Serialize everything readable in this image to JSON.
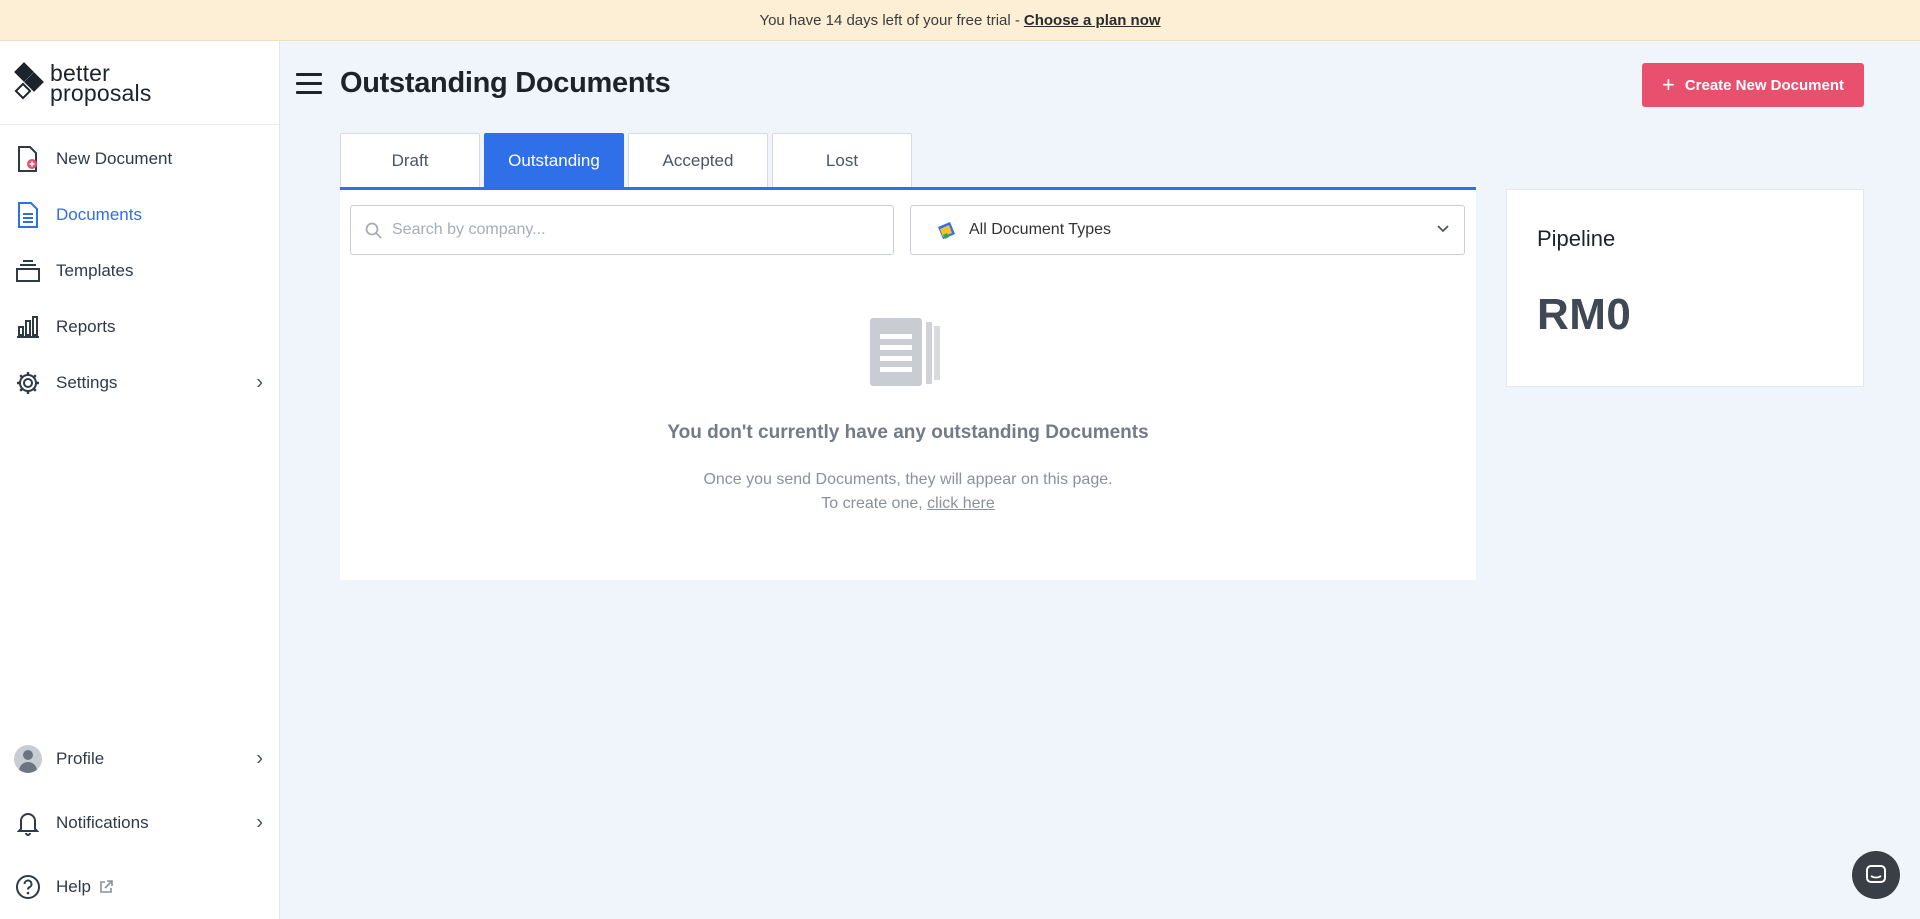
{
  "banner": {
    "text": "You have 14 days left of your free trial -",
    "link": "Choose a plan now"
  },
  "brand": {
    "line1": "better",
    "line2": "proposals"
  },
  "sidebar": {
    "items": [
      {
        "label": "New Document",
        "icon": "new-document-icon"
      },
      {
        "label": "Documents",
        "icon": "documents-icon",
        "active": true
      },
      {
        "label": "Templates",
        "icon": "templates-icon"
      },
      {
        "label": "Reports",
        "icon": "reports-icon"
      },
      {
        "label": "Settings",
        "icon": "gear-icon"
      }
    ],
    "bottom": [
      {
        "label": "Profile",
        "icon": "avatar"
      },
      {
        "label": "Notifications",
        "icon": "bell-icon"
      },
      {
        "label": "Help",
        "icon": "help-icon"
      }
    ]
  },
  "header": {
    "title": "Outstanding Documents",
    "create_label": "Create New Document"
  },
  "tabs": [
    {
      "label": "Draft"
    },
    {
      "label": "Outstanding",
      "active": true
    },
    {
      "label": "Accepted"
    },
    {
      "label": "Lost"
    }
  ],
  "filters": {
    "search_placeholder": "Search by company...",
    "type_selected": "All Document Types"
  },
  "empty_state": {
    "title": "You don't currently have any outstanding Documents",
    "line1": "Once you send Documents, they will appear on this page.",
    "line2_prefix": "To create one,",
    "line2_link": "click here"
  },
  "pipeline": {
    "title": "Pipeline",
    "value": "RM0"
  },
  "colors": {
    "accent": "#2f6fe8",
    "create_button": "#e9506e",
    "banner": "#fcefd6"
  }
}
